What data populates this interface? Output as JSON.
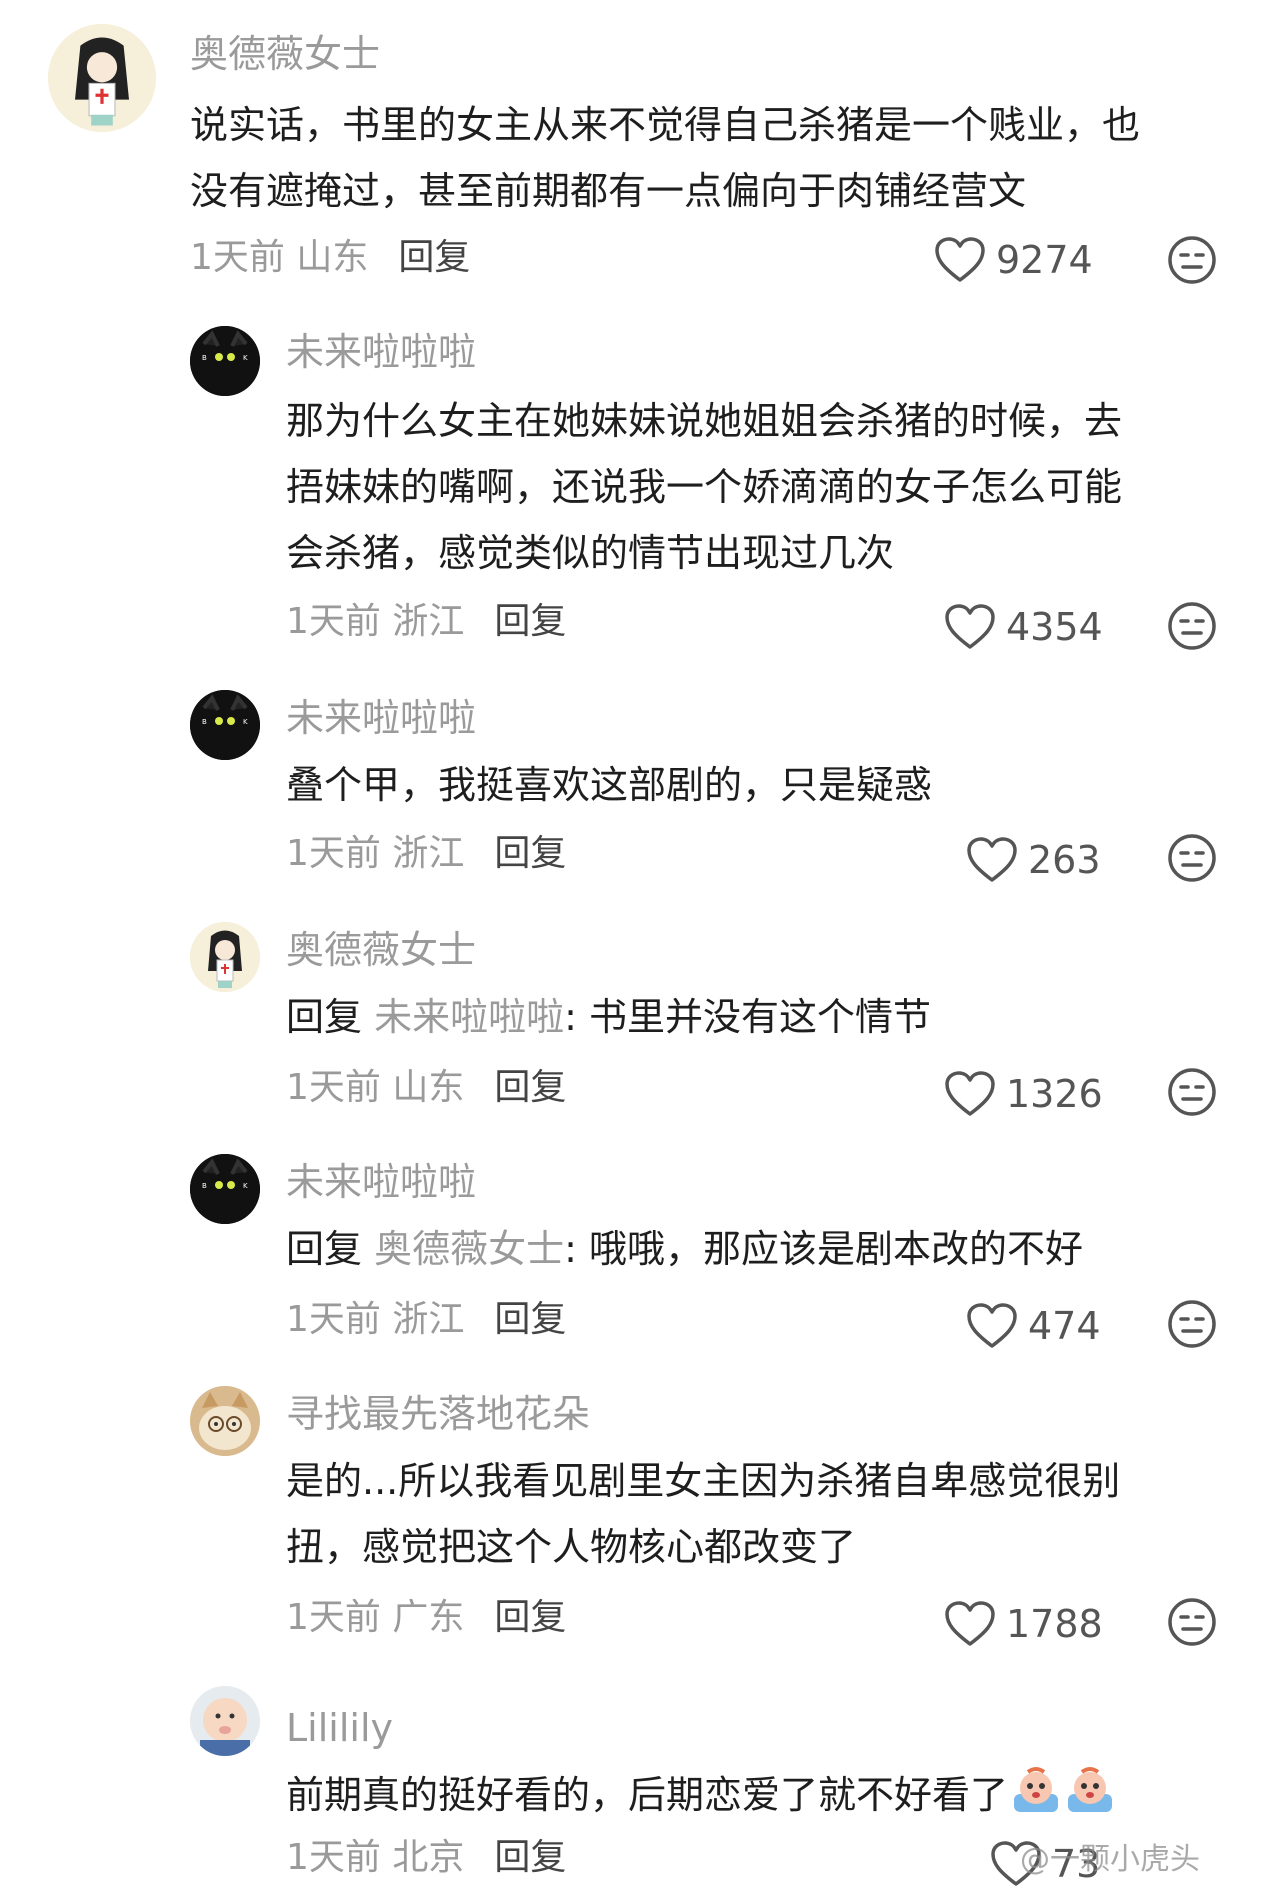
{
  "comments": [
    {
      "username": "奥德薇女士",
      "lines": [
        "说实话，书里的女主从来不觉得自己杀猪是一个贱业，也",
        "没有遮掩过，甚至前期都有一点偏向于肉铺经营文"
      ],
      "meta": "1天前 山东",
      "reply_label": "回复",
      "likes": "9274"
    },
    {
      "username": "未来啦啦啦",
      "lines": [
        "那为什么女主在她妹妹说她姐姐会杀猪的时候，去",
        "捂妹妹的嘴啊，还说我一个娇滴滴的女子怎么可能",
        "会杀猪，感觉类似的情节出现过几次"
      ],
      "meta": "1天前 浙江",
      "reply_label": "回复",
      "likes": "4354"
    },
    {
      "username": "未来啦啦啦",
      "lines": [
        "叠个甲，我挺喜欢这部剧的，只是疑惑"
      ],
      "meta": "1天前 浙江",
      "reply_label": "回复",
      "likes": "263"
    },
    {
      "username": "奥德薇女士",
      "reply_prefix": "回复 ",
      "mention": "未来啦啦啦",
      "reply_text": ": 书里并没有这个情节",
      "meta": "1天前 山东",
      "reply_label": "回复",
      "likes": "1326"
    },
    {
      "username": "未来啦啦啦",
      "reply_prefix": "回复 ",
      "mention": "奥德薇女士",
      "reply_text": ": 哦哦，那应该是剧本改的不好",
      "meta": "1天前 浙江",
      "reply_label": "回复",
      "likes": "474"
    },
    {
      "username": "寻找最先落地花朵",
      "lines": [
        "是的...所以我看见剧里女主因为杀猪自卑感觉很别",
        "扭，感觉把这个人物核心都改变了"
      ],
      "meta": "1天前 广东",
      "reply_label": "回复",
      "likes": "1788"
    },
    {
      "username": "Lililily",
      "lines": [
        "前期真的挺好看的，后期恋爱了就不好看了"
      ],
      "meta": "1天前 北京",
      "reply_label": "回复",
      "likes": "73"
    }
  ],
  "watermark": "@一颗小虎头",
  "icons": {
    "like": "heart-outline-icon",
    "dislike": "neutral-face-icon",
    "emoji": "crying-face-emoji"
  },
  "colors": {
    "text": "#1e1e1e",
    "username": "#9a9a9a",
    "meta": "#9a9a9a"
  }
}
